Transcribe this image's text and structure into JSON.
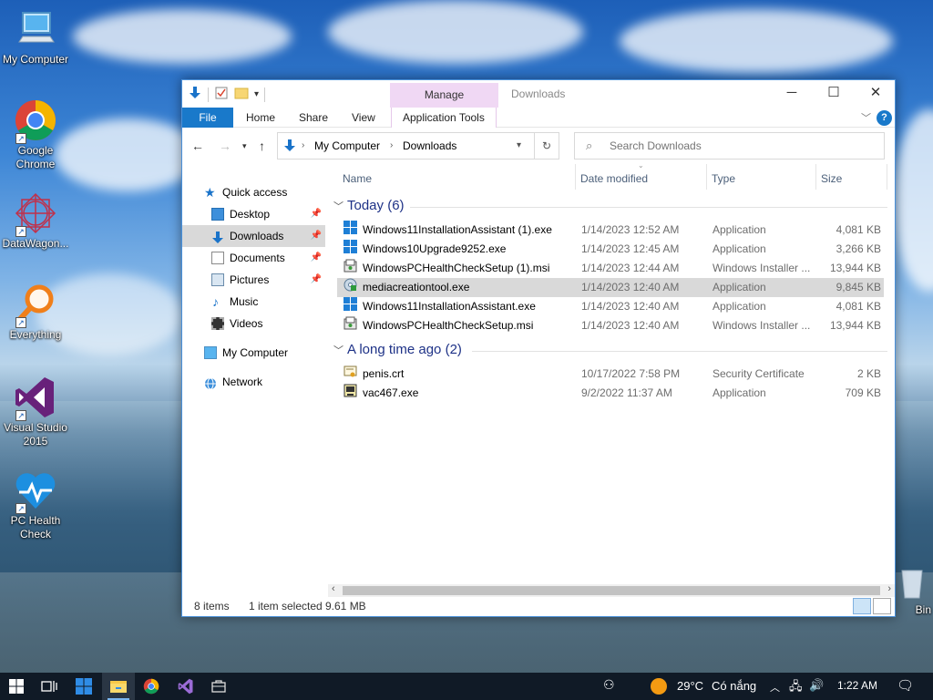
{
  "desktop": {
    "icons": [
      {
        "label": "My Computer"
      },
      {
        "label": "Google Chrome"
      },
      {
        "label": "DataWagon..."
      },
      {
        "label": "Everything"
      },
      {
        "label": "Visual Studio 2015"
      },
      {
        "label": "PC Health Check"
      }
    ],
    "recycle_bin_label": "Bin"
  },
  "window": {
    "title": "Downloads",
    "ribbon": {
      "contextual_tab": "Manage",
      "tabs": [
        "File",
        "Home",
        "Share",
        "View",
        "Application Tools"
      ]
    },
    "address": {
      "root": "My Computer",
      "current": "Downloads"
    },
    "search": {
      "placeholder": "Search Downloads"
    },
    "nav_pane": {
      "quick_access": "Quick access",
      "items": [
        {
          "label": "Desktop",
          "pinned": true
        },
        {
          "label": "Downloads",
          "pinned": true,
          "selected": true
        },
        {
          "label": "Documents",
          "pinned": true
        },
        {
          "label": "Pictures",
          "pinned": true
        },
        {
          "label": "Music",
          "pinned": false
        },
        {
          "label": "Videos",
          "pinned": false
        }
      ],
      "my_computer": "My Computer",
      "network": "Network"
    },
    "columns": [
      "Name",
      "Date modified",
      "Type",
      "Size"
    ],
    "groups": [
      {
        "title": "Today (6)",
        "files": [
          {
            "name": "Windows11InstallationAssistant (1).exe",
            "date": "1/14/2023 12:52 AM",
            "type": "Application",
            "size": "4,081 KB",
            "icon": "windows-logo-icon"
          },
          {
            "name": "Windows10Upgrade9252.exe",
            "date": "1/14/2023 12:45 AM",
            "type": "Application",
            "size": "3,266 KB",
            "icon": "windows-logo-icon"
          },
          {
            "name": "WindowsPCHealthCheckSetup (1).msi",
            "date": "1/14/2023 12:44 AM",
            "type": "Windows Installer ...",
            "size": "13,944 KB",
            "icon": "installer-icon"
          },
          {
            "name": "mediacreationtool.exe",
            "date": "1/14/2023 12:40 AM",
            "type": "Application",
            "size": "9,845 KB",
            "icon": "media-creation-icon",
            "selected": true
          },
          {
            "name": "Windows11InstallationAssistant.exe",
            "date": "1/14/2023 12:40 AM",
            "type": "Application",
            "size": "4,081 KB",
            "icon": "windows-logo-icon"
          },
          {
            "name": "WindowsPCHealthCheckSetup.msi",
            "date": "1/14/2023 12:40 AM",
            "type": "Windows Installer ...",
            "size": "13,944 KB",
            "icon": "installer-icon"
          }
        ]
      },
      {
        "title": "A long time ago (2)",
        "files": [
          {
            "name": "penis.crt",
            "date": "10/17/2022 7:58 PM",
            "type": "Security Certificate",
            "size": "2 KB",
            "icon": "certificate-icon"
          },
          {
            "name": "vac467.exe",
            "date": "9/2/2022 11:37 AM",
            "type": "Application",
            "size": "709 KB",
            "icon": "generic-exe-icon"
          }
        ]
      }
    ],
    "status": {
      "item_count": "8 items",
      "selection": "1 item selected",
      "selection_size": "9.61 MB"
    }
  },
  "taskbar": {
    "weather_temp": "29°C",
    "weather_text": "Có nắng",
    "clock": "1:22 AM"
  },
  "colors": {
    "accent": "#1979ca",
    "taskbar": "#101a26",
    "manage_tab": "#f0d8f4"
  }
}
